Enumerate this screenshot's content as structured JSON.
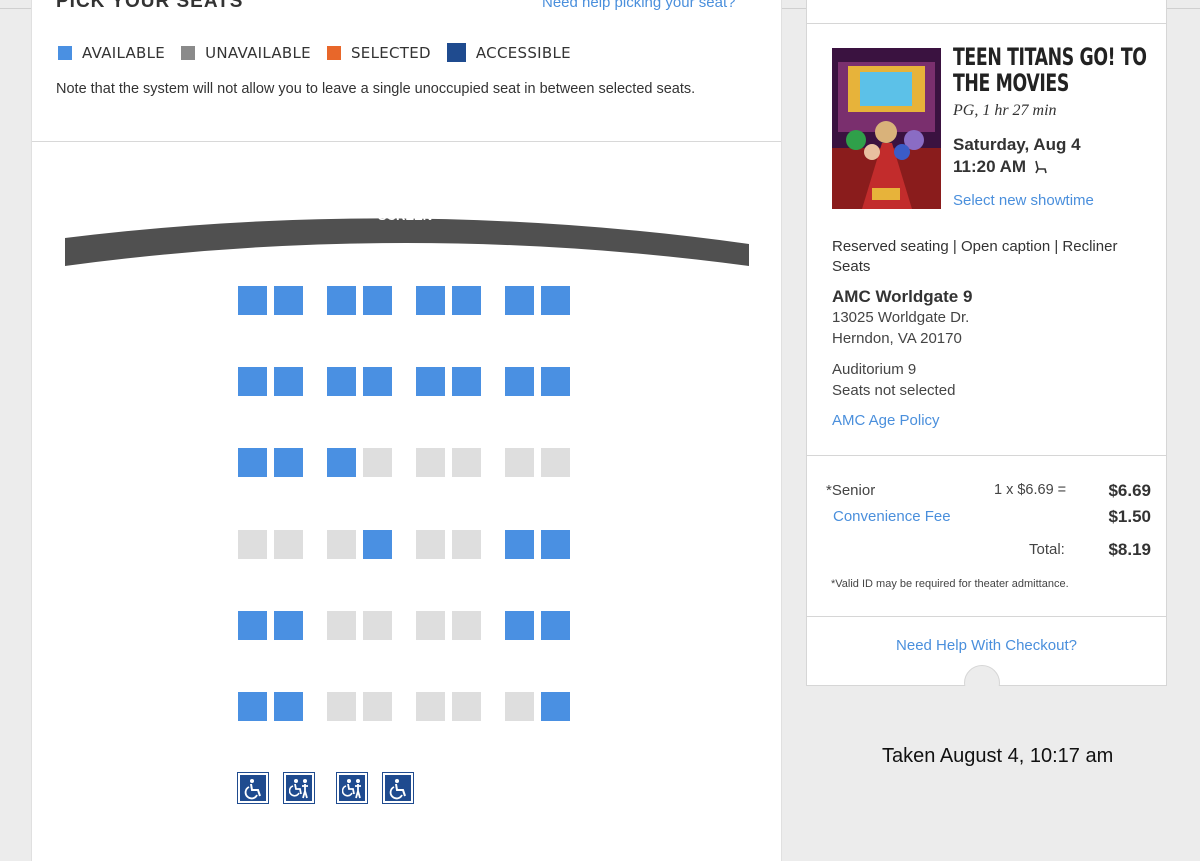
{
  "left": {
    "heading": "PICK YOUR SEATS",
    "help_link": "Need help picking your seat?",
    "legend": [
      {
        "label": "AVAILABLE",
        "color": "#4a90e2"
      },
      {
        "label": "UNAVAILABLE",
        "color": "#8a8a8a"
      },
      {
        "label": "SELECTED",
        "color": "#e8672a"
      },
      {
        "label": "ACCESSIBLE",
        "color": "#1f4b8f"
      }
    ],
    "note": "Note that the system will not allow you to leave a single unoccupied seat in between selected seats.",
    "screen_label": "SCREEN",
    "seat_colors": {
      "available": "#4a90e2",
      "unavailable": "#dedede"
    },
    "seat_rows": [
      [
        "A",
        "A",
        "A",
        "A",
        "A",
        "A",
        "A",
        "A"
      ],
      [
        "A",
        "A",
        "A",
        "A",
        "A",
        "A",
        "A",
        "A"
      ],
      [
        "A",
        "A",
        "A",
        "U",
        "U",
        "U",
        "U",
        "U"
      ],
      [
        "U",
        "U",
        "U",
        "A",
        "U",
        "U",
        "A",
        "A"
      ],
      [
        "A",
        "A",
        "U",
        "U",
        "U",
        "U",
        "A",
        "A"
      ],
      [
        "A",
        "A",
        "U",
        "U",
        "U",
        "U",
        "U",
        "A"
      ]
    ],
    "accessible_seats": [
      {
        "icon": "wheelchair-icon"
      },
      {
        "icon": "companion-icon"
      },
      {
        "icon": "companion-icon"
      },
      {
        "icon": "wheelchair-icon"
      }
    ]
  },
  "right": {
    "movie_title": "TEEN TITANS GO! TO THE MOVIES",
    "rating": "PG, 1 hr 27 min",
    "date": "Saturday, Aug 4",
    "time": "11:20 AM",
    "select_showtime": "Select new showtime",
    "features": "Reserved seating  | Open caption  | Recliner Seats",
    "theater": "AMC Worldgate 9",
    "address1": "13025 Worldgate Dr.",
    "address2": "Herndon, VA 20170",
    "auditorium": "Auditorium 9",
    "seats_status": "Seats not selected",
    "age_policy": "AMC Age Policy",
    "senior_label": "*Senior",
    "senior_calc": "1 x $6.69 =",
    "senior_amount": "$6.69",
    "fee_label": "Convenience Fee",
    "fee_amount": "$1.50",
    "total_label": "Total:",
    "total_amount": "$8.19",
    "valid_id": "*Valid ID may be required for theater admittance.",
    "checkout_help": "Need Help With Checkout?"
  },
  "caption": "Taken August 4, 10:17 am"
}
